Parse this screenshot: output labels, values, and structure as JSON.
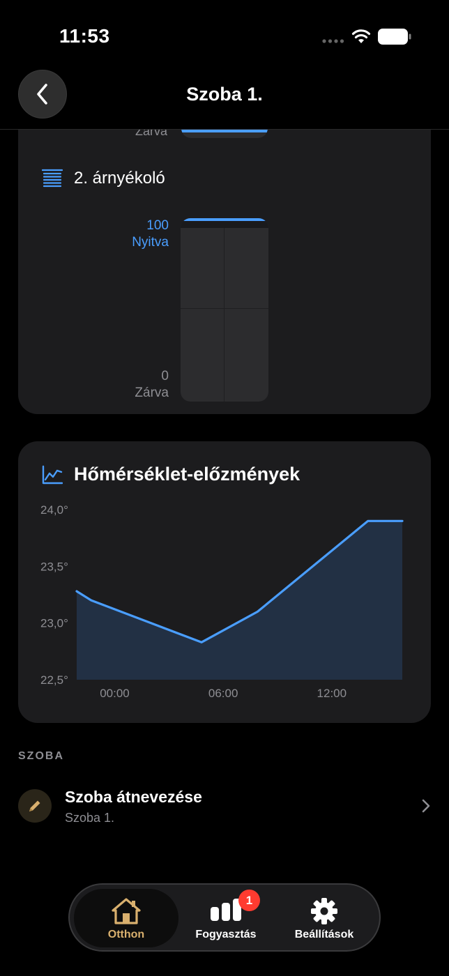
{
  "status_bar": {
    "time": "11:53"
  },
  "header": {
    "title": "Szoba 1."
  },
  "shade_card": {
    "previous_shade_min_label": "Zárva",
    "shade_title": "2. árnyékoló",
    "max_value": "100",
    "max_label": "Nyitva",
    "min_value": "0",
    "min_label": "Zárva",
    "position_percent": 100,
    "accent_color": "#4a9eff"
  },
  "temperature_card": {
    "title": "Hőmérséklet-előzmények",
    "icon": "line-chart-icon"
  },
  "chart_data": {
    "type": "area",
    "title": "Hőmérséklet-előzmények",
    "x_tick_labels": [
      "00:00",
      "06:00",
      "12:00"
    ],
    "y_tick_labels": [
      "24,0°",
      "23,5°",
      "23,0°",
      "22,5°"
    ],
    "y_ticks": [
      24.0,
      23.5,
      23.0,
      22.5
    ],
    "ylim": [
      22.5,
      24.0
    ],
    "xlim": [
      -2.1,
      15.9
    ],
    "x_ticks": [
      0,
      6,
      12
    ],
    "series": [
      {
        "x": [
          -2.1,
          -1.3,
          4.8,
          7.9,
          14.0,
          15.9
        ],
        "y": [
          23.28,
          23.2,
          22.83,
          23.1,
          23.9,
          23.9
        ]
      }
    ],
    "line_color": "#4a9eff",
    "fill_color": "#223044",
    "grid": false
  },
  "room_section": {
    "label": "SZOBA",
    "rename_title": "Szoba átnevezése",
    "rename_subtitle": "Szoba 1."
  },
  "tabbar": {
    "tabs": [
      {
        "label": "Otthon",
        "icon": "home-icon",
        "active": true
      },
      {
        "label": "Fogyasztás",
        "icon": "bar-chart-icon",
        "active": false
      },
      {
        "label": "Beállítások",
        "icon": "gear-icon",
        "active": false
      }
    ],
    "badge_count": "1"
  }
}
